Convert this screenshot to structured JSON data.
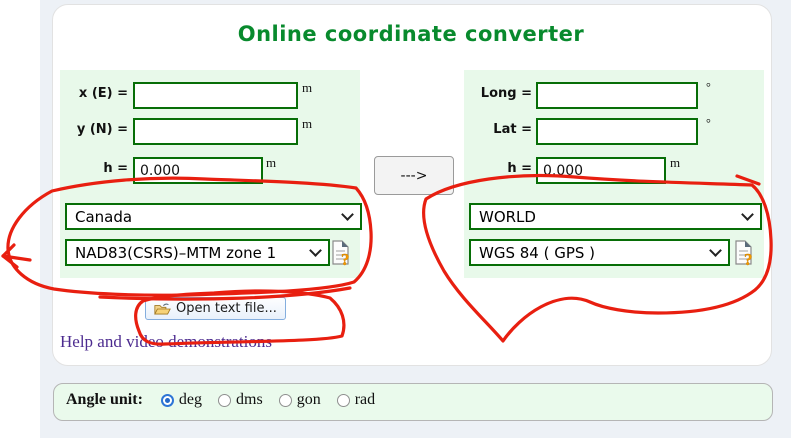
{
  "title": "Online coordinate converter",
  "colors": {
    "title_green": "#088a2d",
    "panel_green": "#e8f9ea",
    "input_border_green": "#076e07",
    "annotation_red": "#e81f10",
    "link_purple": "#4c2b8f",
    "page_background": "#edf1f6"
  },
  "left_panel": {
    "rows": [
      {
        "label": "x (E) =",
        "value": "",
        "unit": "m"
      },
      {
        "label": "y (N) =",
        "value": "",
        "unit": "m"
      },
      {
        "label": "h =",
        "value": "0.000",
        "unit": "m"
      }
    ],
    "region_select": "Canada",
    "datum_select": "NAD83(CSRS)–MTM zone 1"
  },
  "arrow_button_label": "--->",
  "right_panel": {
    "rows": [
      {
        "label": "Long =",
        "value": "",
        "unit": "°"
      },
      {
        "label": "Lat =",
        "value": "",
        "unit": "°"
      },
      {
        "label": "h =",
        "value": "0.000",
        "unit": "m"
      }
    ],
    "region_select": "WORLD",
    "datum_select": "WGS 84 ( GPS )"
  },
  "open_file_button": "Open text file...",
  "help_link": "Help and video demonstrations",
  "angle_unit": {
    "label": "Angle unit:",
    "options": [
      "deg",
      "dms",
      "gon",
      "rad"
    ],
    "selected": "deg"
  }
}
